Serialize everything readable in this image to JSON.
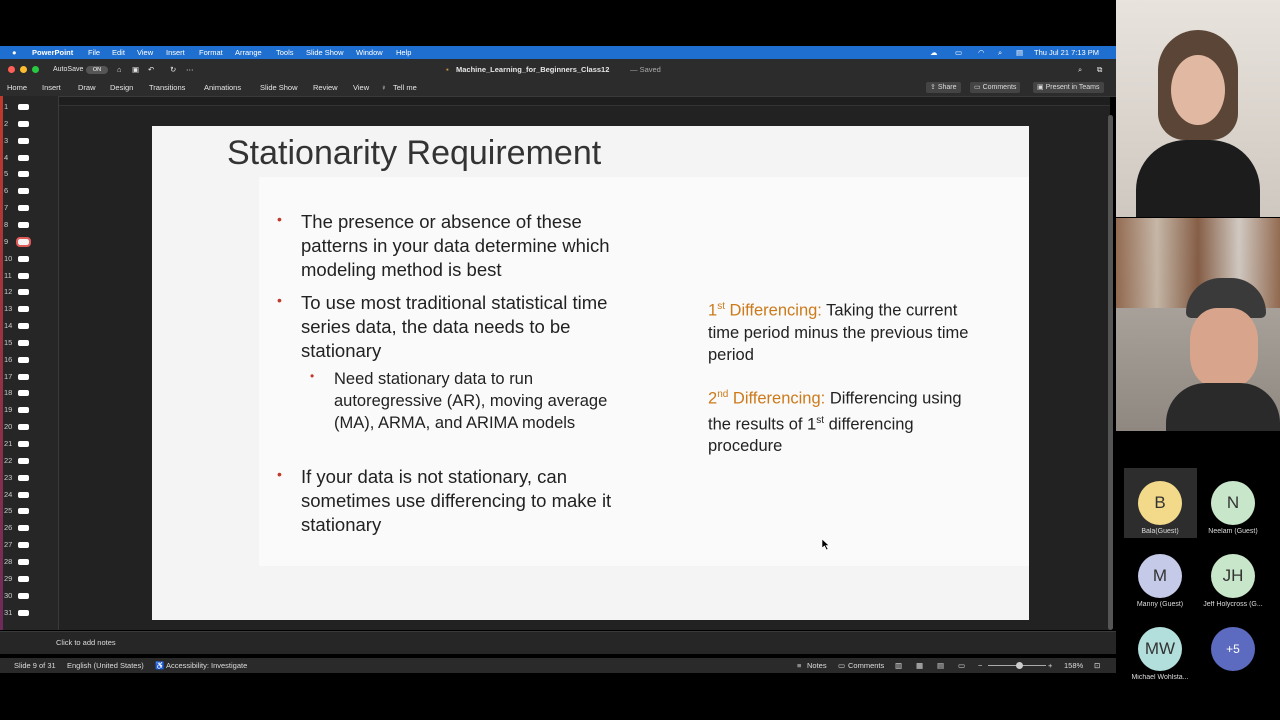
{
  "menubar": {
    "app": "PowerPoint",
    "items": [
      "File",
      "Edit",
      "View",
      "Insert",
      "Format",
      "Arrange",
      "Tools",
      "Slide Show",
      "Window",
      "Help"
    ],
    "clock": "Thu Jul 21  7:13 PM"
  },
  "titlebar": {
    "autosave_label": "AutoSave",
    "autosave_state": "ON",
    "filename": "Machine_Learning_for_Beginners_Class12",
    "saved": "— Saved"
  },
  "ribbon": {
    "tabs": [
      "Home",
      "Insert",
      "Draw",
      "Design",
      "Transitions",
      "Animations",
      "Slide Show",
      "Review",
      "View"
    ],
    "tell_me": "Tell me",
    "share": "Share",
    "comments": "Comments",
    "present": "Present in Teams"
  },
  "thumbnails": {
    "numbers": [
      "1",
      "2",
      "3",
      "4",
      "5",
      "6",
      "7",
      "8",
      "9",
      "10",
      "11",
      "12",
      "13",
      "14",
      "15",
      "16",
      "17",
      "18",
      "19",
      "20",
      "21",
      "22",
      "23",
      "24",
      "25",
      "26",
      "27",
      "28",
      "29",
      "30",
      "31"
    ],
    "selected": "9"
  },
  "slide": {
    "title": "Stationarity Requirement",
    "bullet1": "The presence or absence of these patterns in your data determine which modeling method is best",
    "bullet2": "To use most traditional statistical time series data, the data needs to be stationary",
    "subbullet": "Need stationary data to run autoregressive (AR), moving average (MA), ARMA, and ARIMA models",
    "bullet3": "If your data is not stationary, can sometimes use differencing to make it stationary",
    "diff1_num": "1",
    "diff1_sup": "st",
    "diff1_label": " Differencing:",
    "diff1_text": " Taking the current time period minus the previous time period",
    "diff2_num": "2",
    "diff2_sup": "nd",
    "diff2_label": " Differencing:",
    "diff2_text_a": " Differencing using the results of 1",
    "diff2_text_sup": "st",
    "diff2_text_b": " differencing procedure"
  },
  "notes": {
    "placeholder": "Click to add notes"
  },
  "status": {
    "slide_info": "Slide 9 of 31",
    "language": "English (United States)",
    "accessibility": "Accessibility: Investigate",
    "notes": "Notes",
    "comments": "Comments",
    "zoom": "158%"
  },
  "participants": [
    {
      "initials": "B",
      "name": "Bala(Guest)",
      "color": "#f3d98a"
    },
    {
      "initials": "N",
      "name": "Neelam (Guest)",
      "color": "#c8e6c9"
    },
    {
      "initials": "M",
      "name": "Manny (Guest)",
      "color": "#c5cae9"
    },
    {
      "initials": "JH",
      "name": "Jeff Holycross (G...",
      "color": "#c8e6c9"
    },
    {
      "initials": "MW",
      "name": "Michael Wohlsta...",
      "color": "#b2dfdb"
    },
    {
      "initials": "+5",
      "name": "",
      "color": "#5c6bc0"
    }
  ]
}
